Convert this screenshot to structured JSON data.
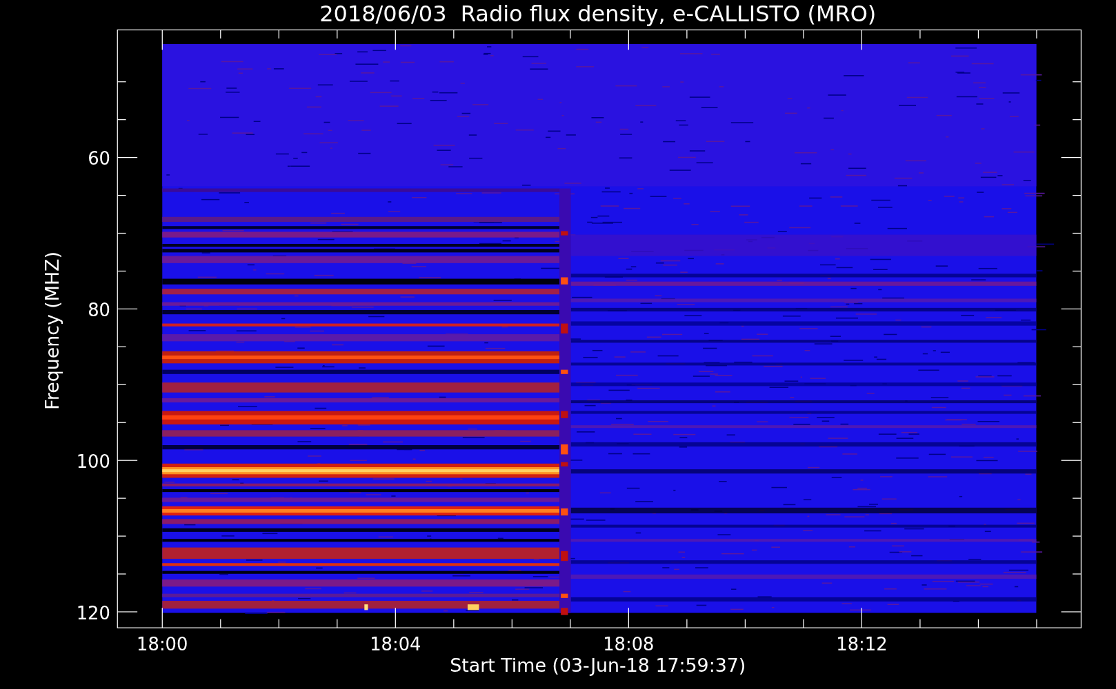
{
  "title": "2018/06/03  Radio flux density, e-CALLISTO (MRO)",
  "xlabel": "Start Time (03-Jun-18 17:59:37)",
  "ylabel": "Frequency (MHZ)",
  "xticks": [
    "18:00",
    "18:04",
    "18:08",
    "18:12"
  ],
  "yticks": [
    "60",
    "80",
    "100",
    "120"
  ]
}
